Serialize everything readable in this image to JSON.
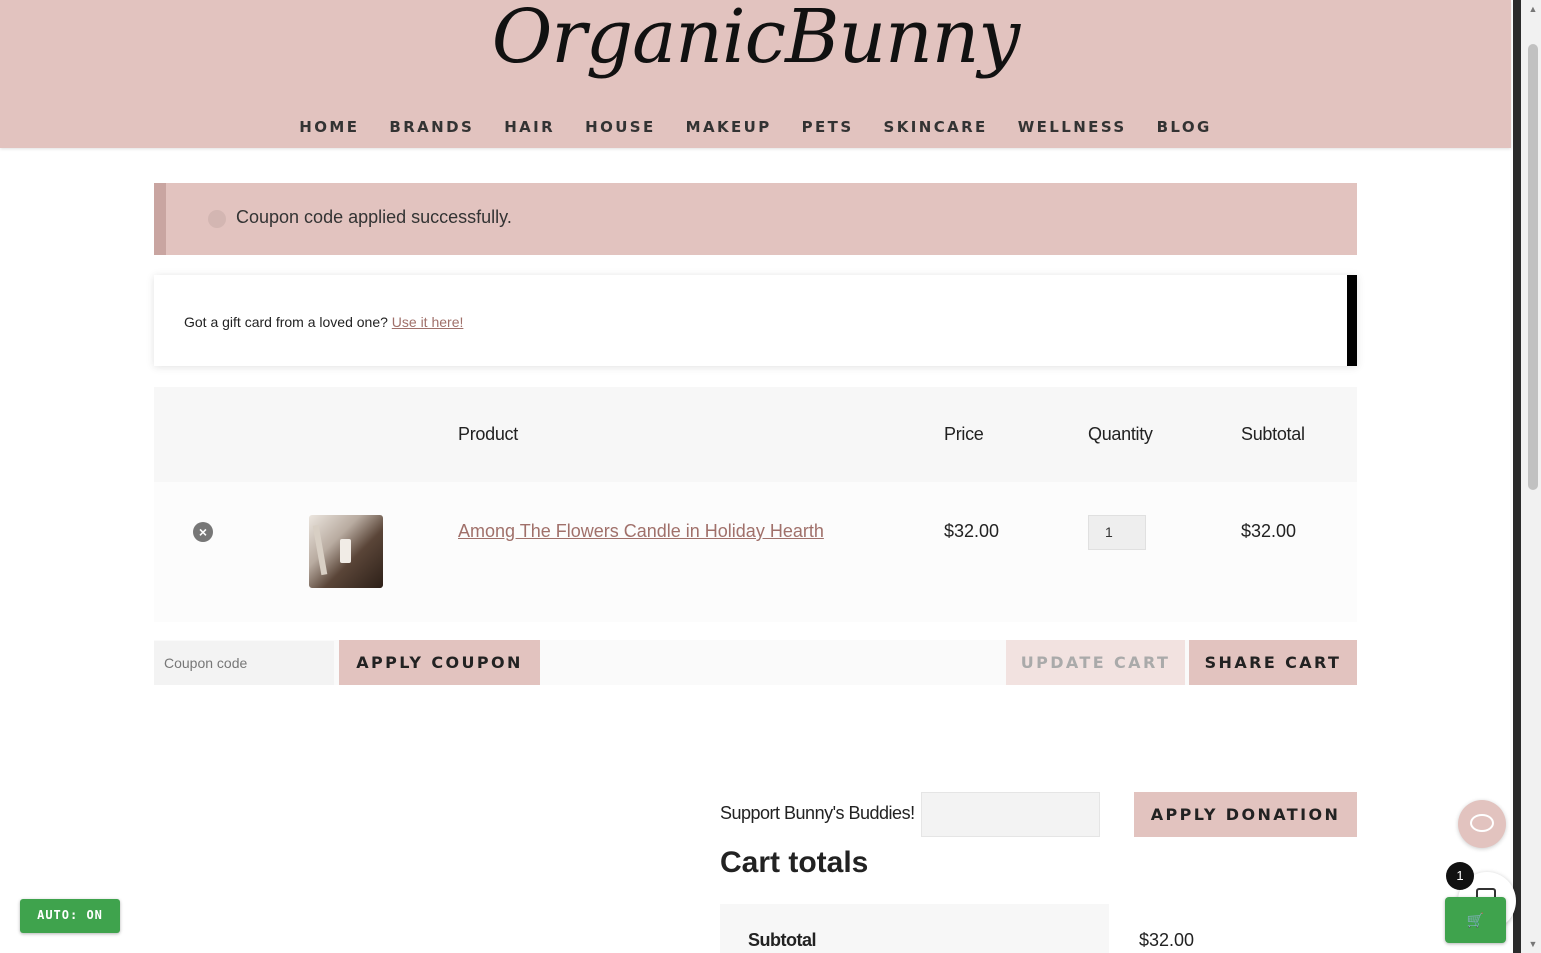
{
  "header": {
    "logo_text": "OrganicBunny",
    "nav": [
      "HOME",
      "BRANDS",
      "HAIR",
      "HOUSE",
      "MAKEUP",
      "PETS",
      "SKINCARE",
      "WELLNESS",
      "BLOG"
    ]
  },
  "notice": {
    "message": "Coupon code applied successfully."
  },
  "gift_card": {
    "text": "Got a gift card from a loved one? ",
    "link": "Use it here!"
  },
  "cart": {
    "columns": {
      "product": "Product",
      "price": "Price",
      "quantity": "Quantity",
      "subtotal": "Subtotal"
    },
    "items": [
      {
        "name": "Among The Flowers Candle in Holiday Hearth",
        "price": "$32.00",
        "quantity": "1",
        "subtotal": "$32.00"
      }
    ]
  },
  "actions": {
    "coupon_placeholder": "Coupon code",
    "apply_coupon": "APPLY COUPON",
    "update_cart": "UPDATE CART",
    "share_cart": "SHARE CART"
  },
  "donation": {
    "label": "Support Bunny's Buddies!",
    "button": "APPLY DONATION"
  },
  "totals": {
    "title": "Cart totals",
    "subtotal_label": "Subtotal",
    "subtotal_value": "$32.00"
  },
  "floating": {
    "auto_badge": "AUTO: ON",
    "cart_count": "1"
  },
  "colors": {
    "brand_pink": "#e2c3bf",
    "link": "#a0706a",
    "auto_green": "#3fa34d"
  }
}
